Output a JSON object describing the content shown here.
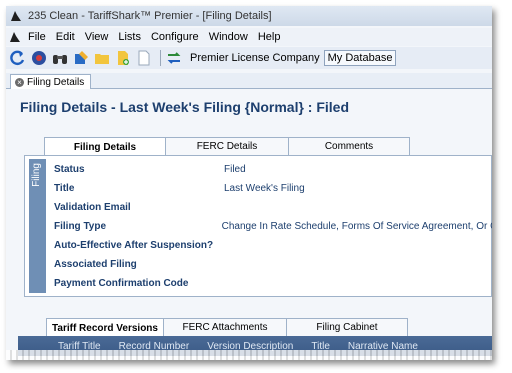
{
  "window": {
    "title": "235 Clean - TariffShark™ Premier - [Filing Details]"
  },
  "menu": {
    "items": [
      "File",
      "Edit",
      "View",
      "Lists",
      "Configure",
      "Window",
      "Help"
    ]
  },
  "toolbar": {
    "company_label": "Premier License Company",
    "database_label": "My Database"
  },
  "doc_tab": {
    "label": "Filing Details"
  },
  "page": {
    "title": "Filing Details - Last Week's Filing {Normal} : Filed"
  },
  "top_tabs": [
    "Filing Details",
    "FERC Details",
    "Comments"
  ],
  "section_label": "Filing",
  "fields": [
    {
      "label": "Status",
      "value": "Filed"
    },
    {
      "label": "Title",
      "value": "Last Week's Filing"
    },
    {
      "label": "Validation Email",
      "value": ""
    },
    {
      "label": "Filing Type",
      "value": "Change In Rate Schedule, Forms Of Service Agreement, Or G"
    },
    {
      "label": "Auto-Effective After Suspension?",
      "value": ""
    },
    {
      "label": "Associated Filing",
      "value": ""
    },
    {
      "label": "Payment Confirmation Code",
      "value": ""
    }
  ],
  "bottom_tabs": [
    "Tariff Record Versions",
    "FERC Attachments",
    "Filing Cabinet"
  ],
  "grid_columns": [
    "Tariff Title",
    "Record Number",
    "Version Description",
    "Title",
    "Narrative Name"
  ]
}
